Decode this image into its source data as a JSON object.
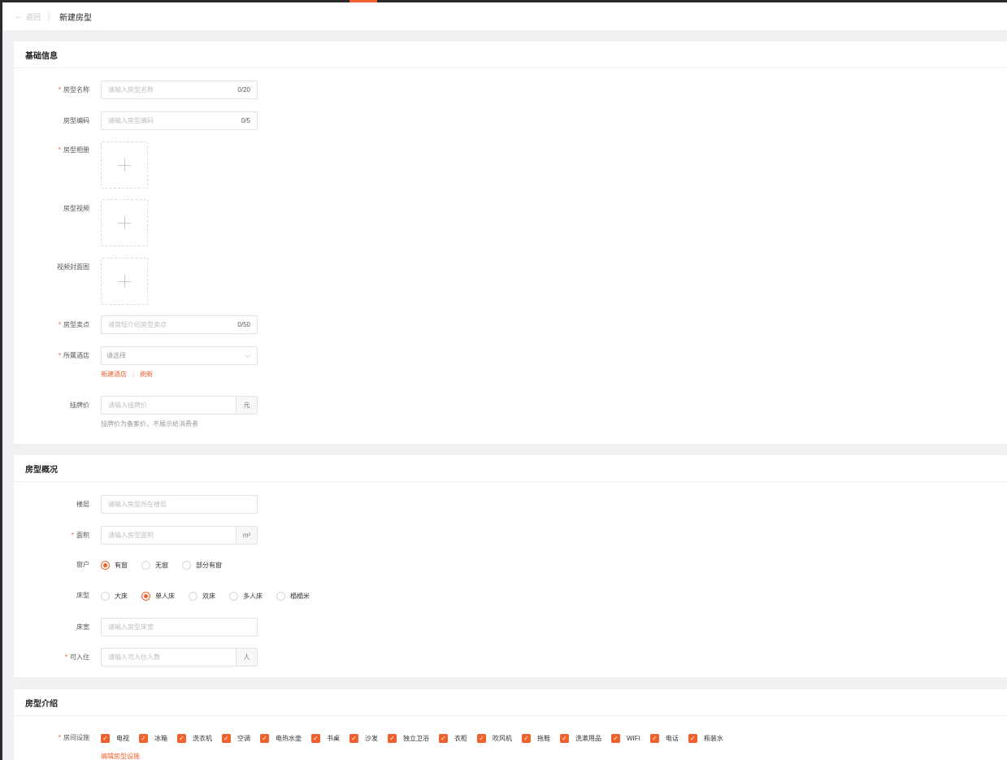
{
  "header": {
    "back_label": "返回",
    "back_icon": "arrow-left-icon",
    "title": "新建房型"
  },
  "colors": {
    "accent": "#f0602c",
    "page_bg": "#f0f0f2"
  },
  "basic": {
    "title": "基础信息",
    "name": {
      "label": "房型名称",
      "required": "*",
      "placeholder": "请输入房型名称",
      "count": "0/20"
    },
    "code": {
      "label": "房型编码",
      "placeholder": "请输入房型编码",
      "count": "0/5"
    },
    "album": {
      "label": "房型相册",
      "required": "*"
    },
    "video": {
      "label": "房型视频"
    },
    "cover": {
      "label": "视频封面图"
    },
    "selling": {
      "label": "房型卖点",
      "required": "*",
      "placeholder": "请简短介绍房型卖点",
      "count": "0/50"
    },
    "hotel": {
      "label": "所属酒店",
      "required": "*",
      "placeholder": "请选择",
      "link_new": "新建酒店",
      "link_sep": "|",
      "link_refresh": "刷新"
    },
    "price": {
      "label": "挂牌价",
      "placeholder": "请输入挂牌价",
      "suffix": "元",
      "hint": "挂牌价为备案价，不展示给消费者"
    }
  },
  "overview": {
    "title": "房型概况",
    "floor": {
      "label": "楼层",
      "placeholder": "请输入房型所在楼层"
    },
    "area": {
      "label": "面积",
      "required": "*",
      "placeholder": "请输入房型面积",
      "suffix": "m²"
    },
    "window": {
      "label": "窗户",
      "options": [
        "有窗",
        "无窗",
        "部分有窗"
      ],
      "selected": "有窗"
    },
    "bed": {
      "label": "床型",
      "options": [
        "大床",
        "单人床",
        "双床",
        "多人床",
        "榻榻米"
      ],
      "selected": "单人床"
    },
    "bed_width": {
      "label": "床宽",
      "placeholder": "请输入房型床宽"
    },
    "capacity": {
      "label": "可入住",
      "required": "*",
      "placeholder": "请输入可入住人数",
      "suffix": "人"
    }
  },
  "intro": {
    "title": "房型介绍",
    "facilities": {
      "label": "房间设施",
      "required": "*",
      "items": [
        "电视",
        "冰箱",
        "洗衣机",
        "空调",
        "电热水壶",
        "书桌",
        "沙发",
        "独立卫浴",
        "衣柜",
        "吹风机",
        "拖鞋",
        "洗漱用品",
        "WIFI",
        "电话",
        "瓶装水"
      ],
      "edit_link": "编辑房型设施"
    }
  }
}
